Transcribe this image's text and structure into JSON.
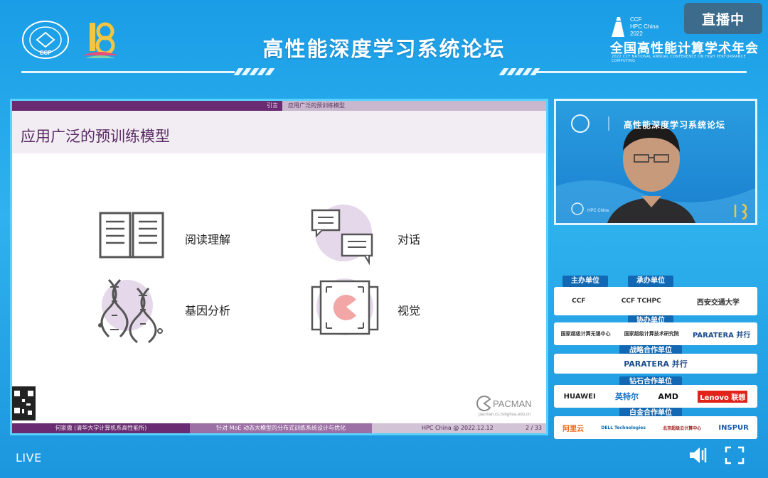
{
  "header": {
    "ccf_logo_text": "中国计算机学会 CCF",
    "forum_title": "高性能深度学习系统论坛",
    "live_badge": "直播中",
    "hpc_logo_text": "CCF HPC China 2022",
    "conference_name": "全国高性能计算学术年会",
    "conference_subtitle": "2022 CCF NATIONAL ANNUAL CONFERENCE ON HIGH PERFORMANCE COMPUTING"
  },
  "slide": {
    "breadcrumb_left": "引言",
    "breadcrumb_right": "应用广泛的预训练模型",
    "title": "应用广泛的预训练模型",
    "topics": [
      {
        "label": "阅读理解",
        "icon": "open-book-icon"
      },
      {
        "label": "对话",
        "icon": "chat-bubbles-icon"
      },
      {
        "label": "基因分析",
        "icon": "dna-icon"
      },
      {
        "label": "视觉",
        "icon": "image-frames-icon"
      }
    ],
    "pacman_logo": "PACMAN",
    "pacman_url": "pacman.cs.tsinghua.edu.cn",
    "footer": {
      "speaker": "何家傲 (清华大学计算机系高性能所)",
      "talk": "针对 MoE 动态大模型的分布式训练系统设计与优化",
      "event": "HPC China @ 2022.12.12",
      "page": "2 / 33"
    }
  },
  "video": {
    "banner_title": "高性能深度学习系统论坛"
  },
  "sponsors": {
    "host_label": "主办单位",
    "organizer_label": "承办单位",
    "host_org": "CCF",
    "organizer_org": "CCF TCHPC",
    "university": "西安交通大学",
    "co_label": "协办单位",
    "co_orgs": [
      "国家超级计算无锡中心",
      "国家超级计算技术研究院",
      "PARATERA 并行"
    ],
    "strategic_label": "战略合作单位",
    "strategic_orgs": [
      "PARATERA 并行"
    ],
    "diamond_label": "钻石合作单位",
    "diamond_orgs": [
      "HUAWEI",
      "英特尔",
      "AMD",
      "Lenovo 联想"
    ],
    "platinum_label": "白金合作单位",
    "platinum_orgs": [
      "阿里云",
      "DELL Technologies",
      "北京超级云计算中心",
      "INSPUR"
    ]
  },
  "controls": {
    "live_label": "LIVE",
    "volume": "volume-icon",
    "fullscreen": "fullscreen-icon"
  },
  "colors": {
    "background": "#1f9fe6",
    "slide_purple": "#6a2b72",
    "live_badge": "#3d6b8b",
    "sponsor_tag": "#1268b3"
  }
}
